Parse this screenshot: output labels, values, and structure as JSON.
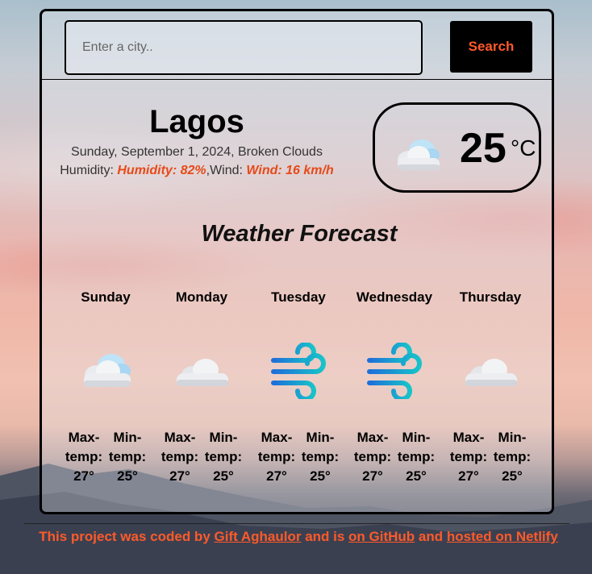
{
  "search": {
    "placeholder": "Enter a city..",
    "button_label": "Search"
  },
  "current": {
    "city": "Lagos",
    "date_line": "Sunday, September 1, 2024, Broken Clouds",
    "humidity_label": "Humidity: ",
    "humidity_value": "Humidity: 82%",
    "wind_label": ",Wind: ",
    "wind_value": "Wind: 16 km/h",
    "temperature": "25",
    "unit": "°C",
    "icon": "broken-clouds-icon"
  },
  "forecast": {
    "title": "Weather Forecast",
    "days": [
      {
        "name": "Sunday",
        "icon": "broken-clouds-icon",
        "max_label": "Max-temp:",
        "max": "27°",
        "min_label": "Min-temp:",
        "min": "25°"
      },
      {
        "name": "Monday",
        "icon": "overcast-clouds-icon",
        "max_label": "Max-temp:",
        "max": "27°",
        "min_label": "Min-temp:",
        "min": "25°"
      },
      {
        "name": "Tuesday",
        "icon": "wind-icon",
        "max_label": "Max-temp:",
        "max": "27°",
        "min_label": "Min-temp:",
        "min": "25°"
      },
      {
        "name": "Wednesday",
        "icon": "wind-icon",
        "max_label": "Max-temp:",
        "max": "27°",
        "min_label": "Min-temp:",
        "min": "25°"
      },
      {
        "name": "Thursday",
        "icon": "overcast-clouds-icon",
        "max_label": "Max-temp:",
        "max": "27°",
        "min_label": "Min-temp:",
        "min": "25°"
      }
    ]
  },
  "footer": {
    "text_1": "This project was coded by ",
    "author_link": "Gift Aghaulor",
    "text_2": " and is ",
    "github_link": "on GitHub",
    "text_3": " and ",
    "host_link": "hosted on Netlify"
  },
  "colors": {
    "accent": "#ff5a2a",
    "detail_accent": "#e64a19",
    "button_bg": "#000000"
  }
}
